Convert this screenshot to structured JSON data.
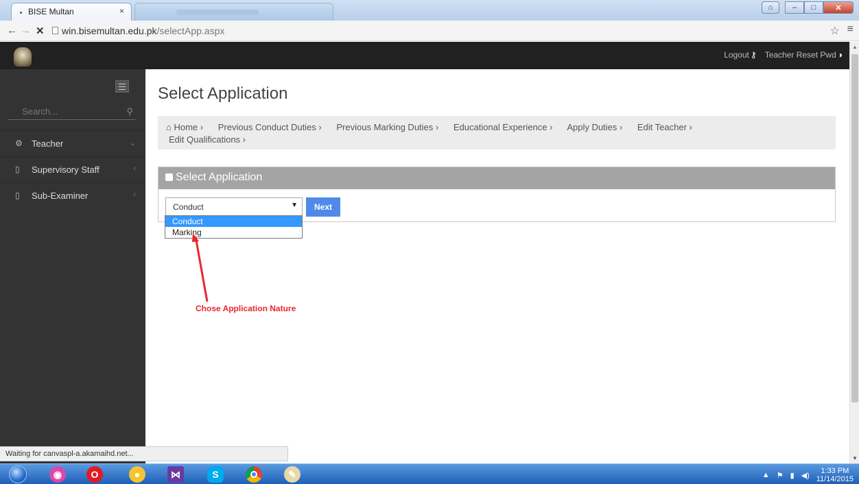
{
  "browser": {
    "tab_title": "BISE Multan",
    "tab_close": "×",
    "url_domain": "win.bisemultan.edu.pk",
    "url_path": "/selectApp.aspx",
    "back_glyph": "←",
    "forward_glyph": "→",
    "stop_glyph": "✕",
    "star_glyph": "☆",
    "menu_glyph": "≡"
  },
  "topnav": {
    "logout_label": "Logout",
    "reset_label": "Teacher Reset Pwd"
  },
  "sidebar": {
    "search_placeholder": "Search...",
    "items": [
      {
        "label": "Teacher",
        "icon": "gears-icon",
        "chevron": "⌄"
      },
      {
        "label": "Supervisory Staff",
        "icon": "bookmark-icon",
        "chevron": "‹"
      },
      {
        "label": "Sub-Examiner",
        "icon": "bookmark-icon",
        "chevron": "‹"
      }
    ]
  },
  "main": {
    "page_title": "Select Application",
    "breadcrumb": [
      "Home",
      "Previous Conduct Duties",
      "Previous Marking Duties",
      "Educational Experience",
      "Apply Duties",
      "Edit Teacher",
      "Edit Qualifications"
    ],
    "panel_title": "Select Application",
    "select_value": "Conduct",
    "next_label": "Next",
    "dropdown_options": [
      "Conduct",
      "Marking"
    ],
    "annotation": "Chose Application Nature"
  },
  "status_text": "Waiting for canvaspl-a.akamaihd.net...",
  "taskbar": {
    "time": "1:33 PM",
    "date": "11/14/2015"
  },
  "colors": {
    "accent_button": "#4f8ae9",
    "annotation": "#e8262d",
    "sidebar_bg": "#333333",
    "topnav_bg": "#212121"
  }
}
